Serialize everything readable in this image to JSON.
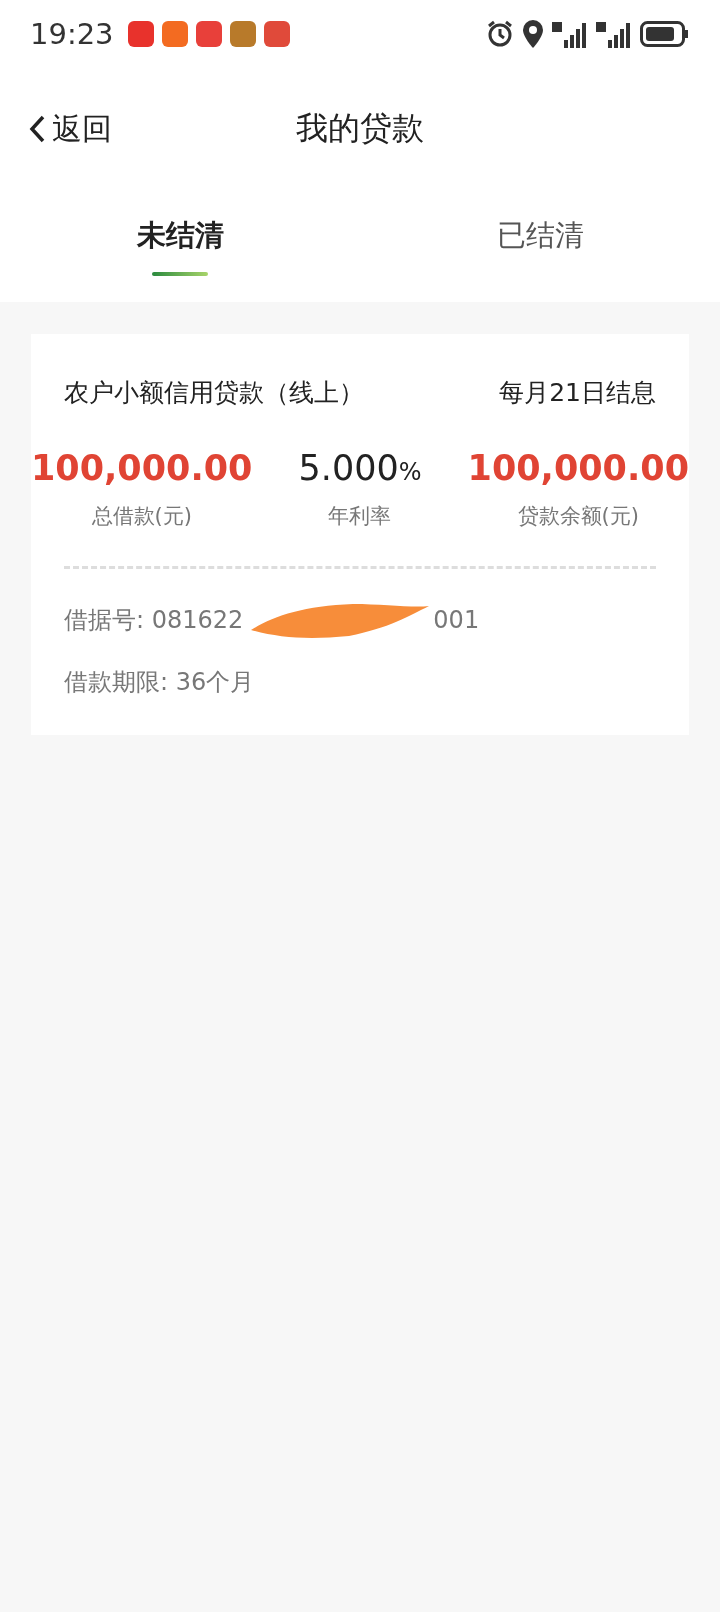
{
  "status_bar": {
    "time": "19:23"
  },
  "header": {
    "back": "返回",
    "title": "我的贷款"
  },
  "tabs": [
    {
      "label": "未结清",
      "selected": true
    },
    {
      "label": "已结清",
      "selected": false
    }
  ],
  "loan": {
    "name": "农户小额信用贷款（线上）",
    "settlement": "每月21日结息",
    "stats": [
      {
        "value": "100,000.00",
        "label": "总借款(元)",
        "kind": "amount"
      },
      {
        "value": "5.000",
        "unit": "%",
        "label": "年利率",
        "kind": "rate"
      },
      {
        "value": "100,000.00",
        "label": "贷款余额(元)",
        "kind": "amount"
      }
    ],
    "number_start": "借据号: 081622",
    "number_end": "001",
    "term": "借款期限: 36个月"
  }
}
